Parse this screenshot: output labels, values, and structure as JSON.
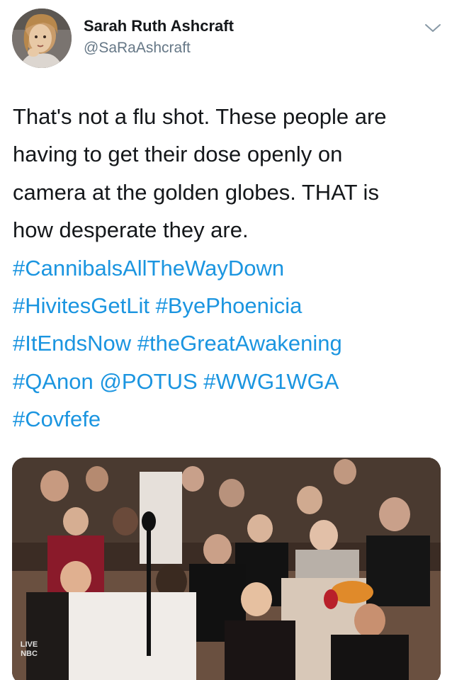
{
  "author": {
    "name": "Sarah Ruth Ashcraft",
    "handle": "@SaRaAshcraft"
  },
  "tweet": {
    "lines": [
      [
        {
          "text": "That's not a flu shot. These people are",
          "type": "text"
        }
      ],
      [
        {
          "text": "having to get their dose openly on",
          "type": "text"
        }
      ],
      [
        {
          "text": "camera at the golden globes. THAT is",
          "type": "text"
        }
      ],
      [
        {
          "text": "how desperate they are.",
          "type": "text"
        }
      ],
      [
        {
          "text": "#CannibalsAllTheWayDown",
          "type": "hashtag"
        }
      ],
      [
        {
          "text": "#HivitesGetLit",
          "type": "hashtag"
        },
        {
          "text": " ",
          "type": "space"
        },
        {
          "text": "#ByePhoenicia",
          "type": "hashtag"
        }
      ],
      [
        {
          "text": "#ItEndsNow",
          "type": "hashtag"
        },
        {
          "text": " ",
          "type": "space"
        },
        {
          "text": "#theGreatAwakening",
          "type": "hashtag"
        }
      ],
      [
        {
          "text": "#QAnon",
          "type": "hashtag"
        },
        {
          "text": " ",
          "type": "space"
        },
        {
          "text": "@POTUS",
          "type": "mention"
        },
        {
          "text": " ",
          "type": "space"
        },
        {
          "text": "#WWG1WGA",
          "type": "hashtag"
        }
      ],
      [
        {
          "text": "#Covfefe",
          "type": "hashtag"
        }
      ]
    ]
  },
  "media": {
    "live_label": "LIVE",
    "network_label": "NBC"
  },
  "icons": {
    "menu": "chevron-down-icon"
  },
  "colors": {
    "link": "#1b95e0",
    "text": "#14171a",
    "secondary": "#657786"
  }
}
